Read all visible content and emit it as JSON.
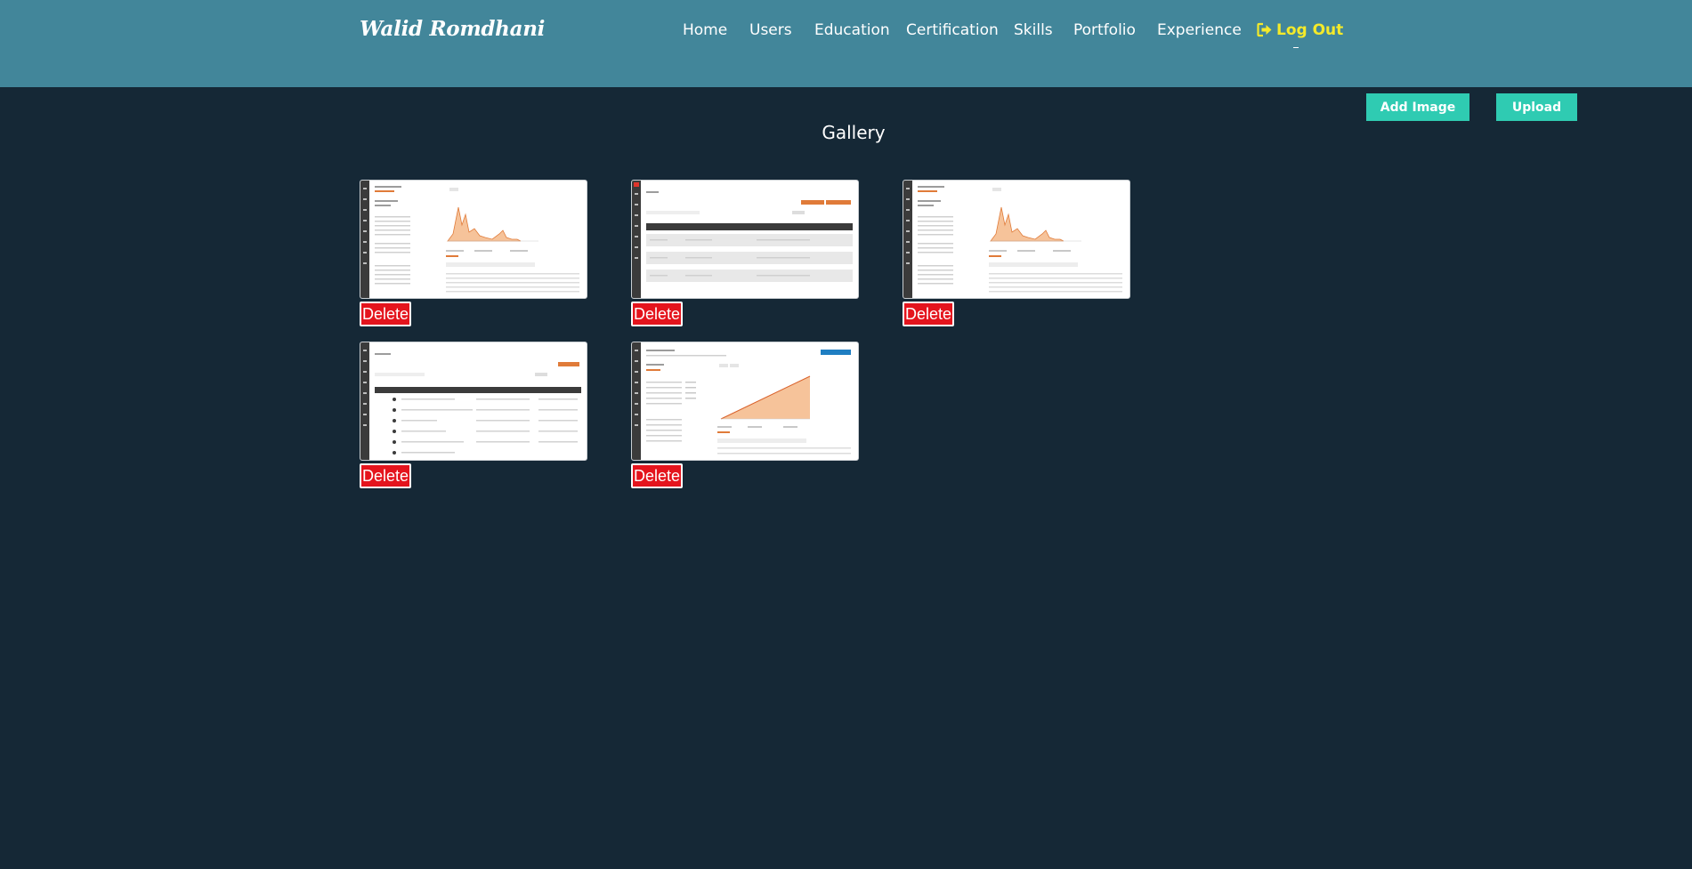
{
  "header": {
    "brand": "Walid Romdhani",
    "nav": [
      {
        "label": "Home"
      },
      {
        "label": "Users"
      },
      {
        "label": "Education"
      },
      {
        "label": "Certification"
      },
      {
        "label": "Skills"
      },
      {
        "label": "Portfolio"
      },
      {
        "label": "Experience"
      }
    ],
    "logout_label": "Log Out",
    "logout_icon": "sign-out-icon"
  },
  "actions": {
    "add_image_label": "Add Image",
    "upload_label": "Upload"
  },
  "gallery": {
    "title": "Gallery",
    "items": [
      {
        "thumbnail": "dashboard-area-chart-screenshot",
        "delete_label": "Delete"
      },
      {
        "thumbnail": "orders-table-screenshot",
        "delete_label": "Delete"
      },
      {
        "thumbnail": "dashboard-area-chart-screenshot",
        "delete_label": "Delete"
      },
      {
        "thumbnail": "products-table-screenshot",
        "delete_label": "Delete"
      },
      {
        "thumbnail": "dashboard-linear-chart-screenshot",
        "delete_label": "Delete"
      }
    ]
  },
  "colors": {
    "header_bg": "#42869a",
    "page_bg": "#152836",
    "accent_teal": "#2fcbb2",
    "delete_red": "#e4141d",
    "logout_yellow": "#f4ea2a"
  }
}
